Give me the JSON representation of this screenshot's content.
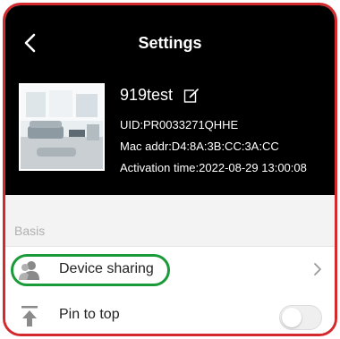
{
  "header": {
    "title": "Settings",
    "back_icon": "chevron-left-icon"
  },
  "device": {
    "name": "919test",
    "uid": "UID:PR0033271QHHE",
    "mac": "Mac addr:D4:8A:3B:CC:3A:CC",
    "activation": "Activation time:2022-08-29 13:00:08",
    "edit_icon": "edit-icon"
  },
  "section": {
    "basis_label": "Basis"
  },
  "rows": {
    "device_sharing": {
      "label": "Device sharing",
      "icon": "users-icon",
      "trailing_icon": "chevron-right-icon",
      "highlighted": true
    },
    "pin_to_top": {
      "label": "Pin to top",
      "icon": "pin-to-top-icon",
      "toggle_on": false
    }
  },
  "colors": {
    "frame_border": "#d42a2d",
    "highlight_ring": "#1b9a3a",
    "header_bg": "#000000",
    "page_bg": "#f3f3f3"
  }
}
